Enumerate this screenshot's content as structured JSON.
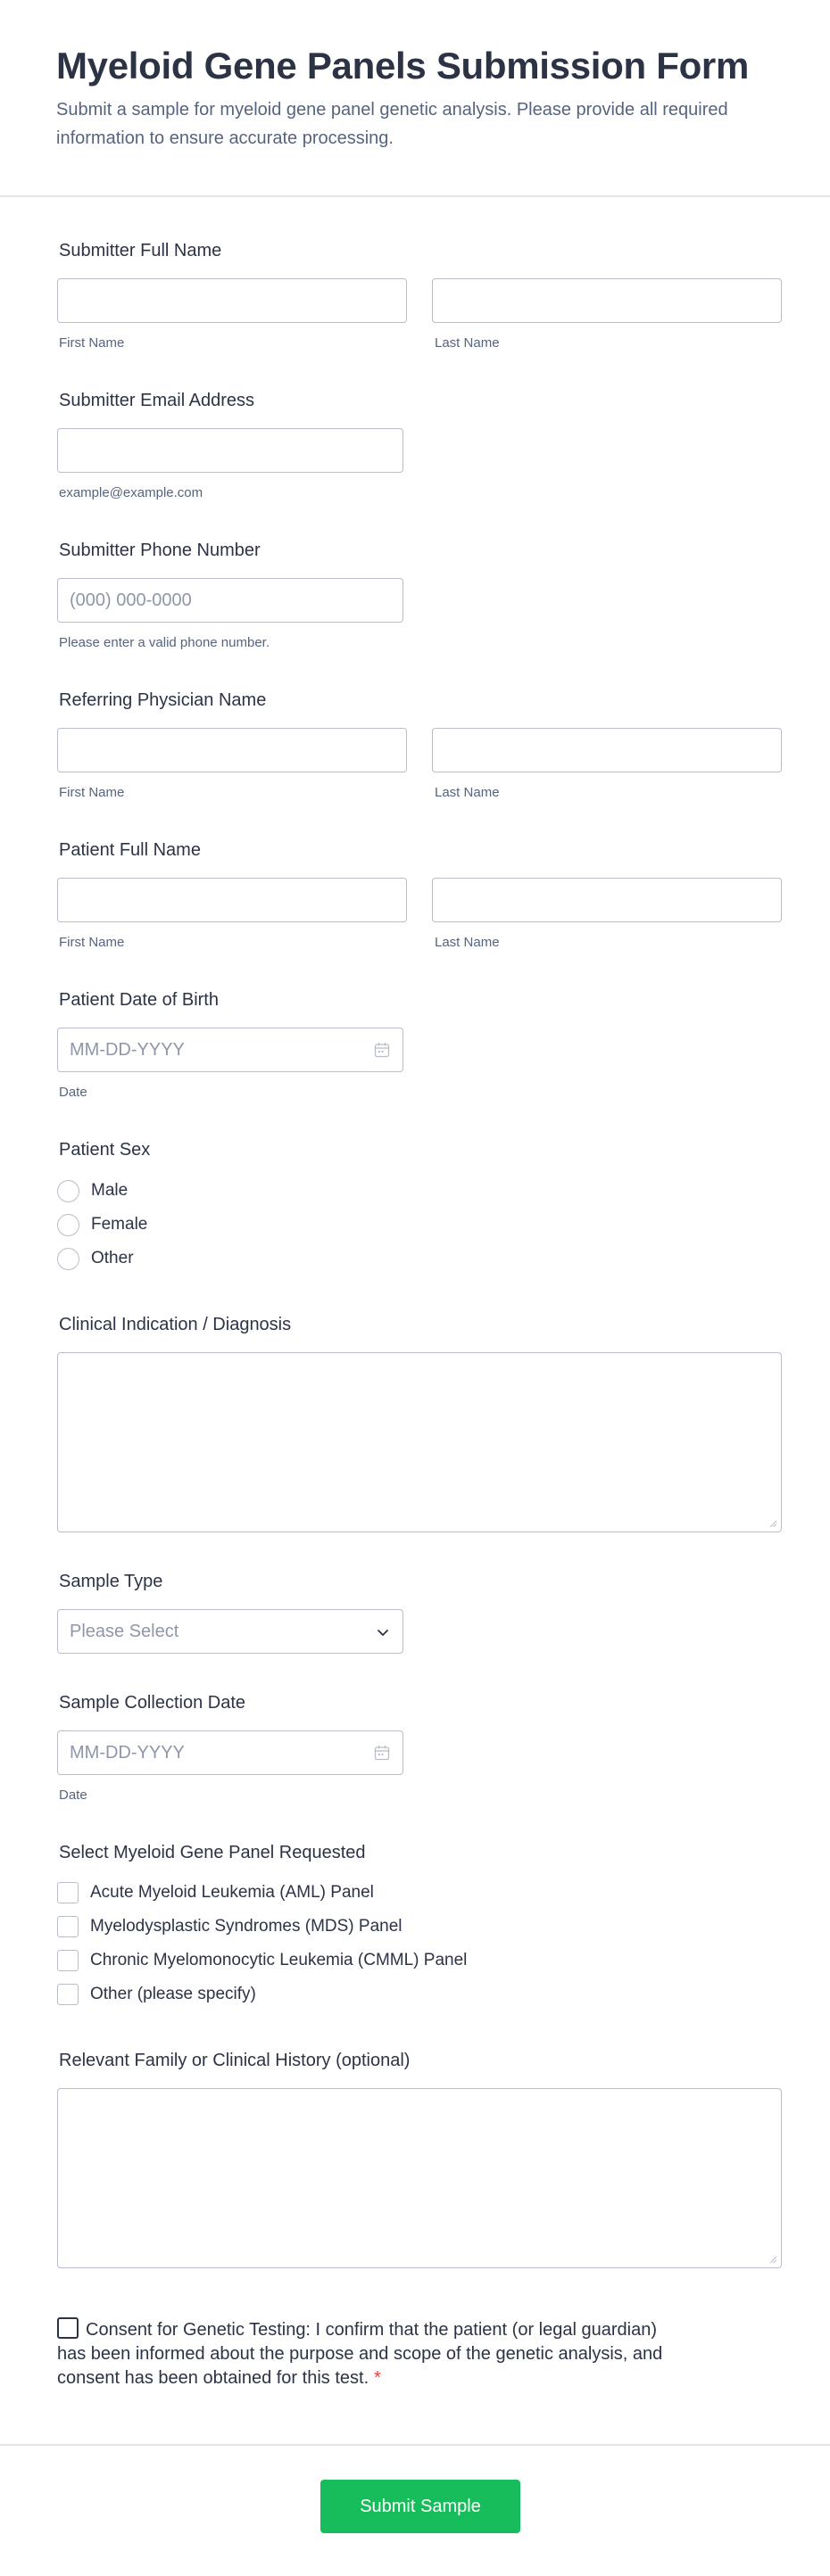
{
  "header": {
    "title": "Myeloid Gene Panels Submission Form",
    "description": "Submit a sample for myeloid gene panel genetic analysis. Please provide all required information to ensure accurate processing."
  },
  "submitter_name": {
    "label": "Submitter Full Name",
    "first_sub": "First Name",
    "last_sub": "Last Name"
  },
  "submitter_email": {
    "label": "Submitter Email Address",
    "sub": "example@example.com"
  },
  "submitter_phone": {
    "label": "Submitter Phone Number",
    "placeholder": "(000) 000-0000",
    "sub": "Please enter a valid phone number."
  },
  "physician_name": {
    "label": "Referring Physician Name",
    "first_sub": "First Name",
    "last_sub": "Last Name"
  },
  "patient_name": {
    "label": "Patient Full Name",
    "first_sub": "First Name",
    "last_sub": "Last Name"
  },
  "patient_dob": {
    "label": "Patient Date of Birth",
    "placeholder": "MM-DD-YYYY",
    "sub": "Date"
  },
  "patient_sex": {
    "label": "Patient Sex",
    "options": [
      "Male",
      "Female",
      "Other"
    ]
  },
  "clinical_indication": {
    "label": "Clinical Indication / Diagnosis"
  },
  "sample_type": {
    "label": "Sample Type",
    "selected": "Please Select"
  },
  "collection_date": {
    "label": "Sample Collection Date",
    "placeholder": "MM-DD-YYYY",
    "sub": "Date"
  },
  "gene_panel": {
    "label": "Select Myeloid Gene Panel Requested",
    "options": [
      "Acute Myeloid Leukemia (AML) Panel",
      "Myelodysplastic Syndromes (MDS) Panel",
      "Chronic Myelomonocytic Leukemia (CMML) Panel",
      "Other (please specify)"
    ]
  },
  "history": {
    "label": "Relevant Family or Clinical History (optional)"
  },
  "consent": {
    "text": "Consent for Genetic Testing: I confirm that the patient (or legal guardian) has been informed about the purpose and scope of the genetic analysis, and consent has been obtained for this test.",
    "required_mark": "*"
  },
  "submit": {
    "label": "Submit Sample"
  },
  "colors": {
    "accent": "#18bd5b",
    "required": "#f23a3c",
    "text": "#2c3345",
    "muted": "#57647e"
  },
  "icons": {
    "calendar": "calendar-icon",
    "chevron": "chevron-down-icon",
    "resize": "resize-handle-icon"
  }
}
